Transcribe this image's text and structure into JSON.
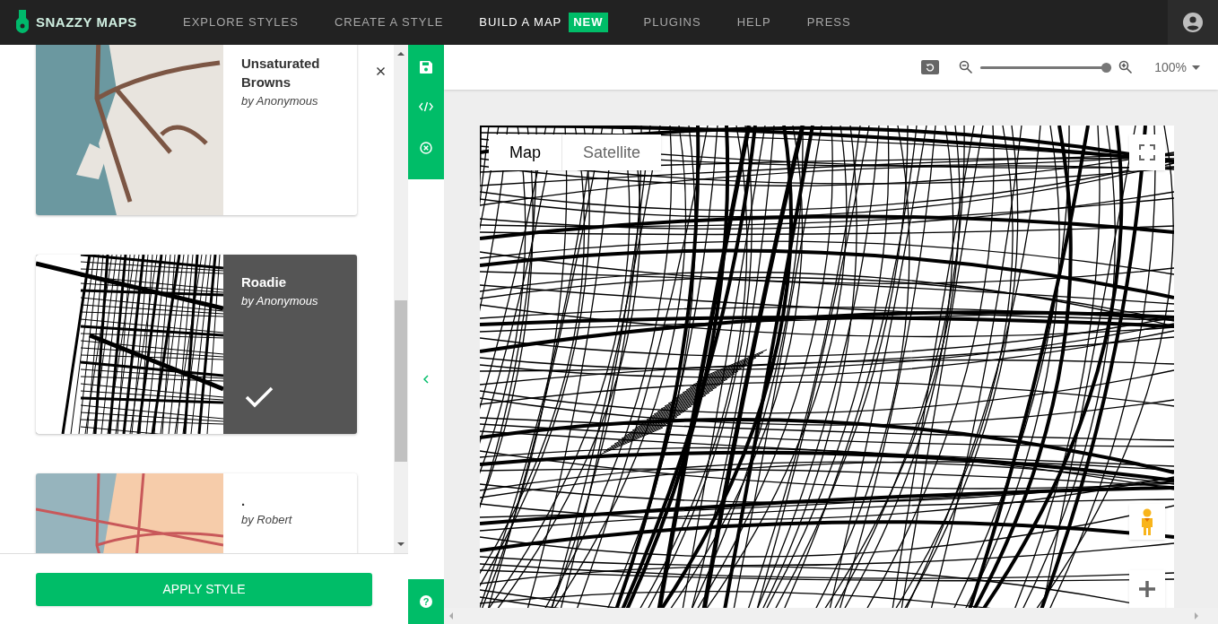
{
  "header": {
    "logo": "SNAZZY MAPS",
    "nav": [
      {
        "label": "EXPLORE STYLES",
        "selected": false
      },
      {
        "label": "CREATE A STYLE",
        "selected": false
      },
      {
        "label": "BUILD A MAP",
        "selected": true,
        "badge": "NEW"
      },
      {
        "label": "PLUGINS",
        "selected": false
      },
      {
        "label": "HELP",
        "selected": false
      },
      {
        "label": "PRESS",
        "selected": false
      }
    ]
  },
  "styles": [
    {
      "name": "Unsaturated Browns",
      "author": "by Anonymous",
      "selected": false,
      "kind": "browns"
    },
    {
      "name": "Roadie",
      "author": "by Anonymous",
      "selected": true,
      "kind": "roadie"
    },
    {
      "name": ".",
      "author": "by Robert",
      "selected": false,
      "kind": "pastel"
    }
  ],
  "help_label": "?",
  "apply_button": "APPLY STYLE",
  "toolbar": {
    "zoom": {
      "level": 1.0,
      "reading": "100%"
    }
  },
  "map_types": [
    {
      "label": "Map",
      "selected": true
    },
    {
      "label": "Satellite",
      "selected": false
    }
  ]
}
